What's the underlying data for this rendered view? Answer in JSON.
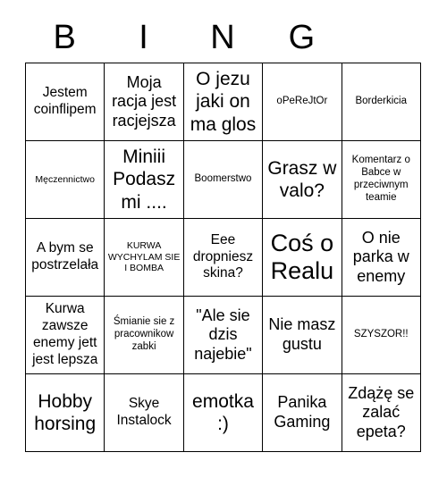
{
  "card": {
    "title_letters": [
      "B",
      "I",
      "N",
      "G",
      ""
    ],
    "columns": 5,
    "rows": 5,
    "border_color": "#000000",
    "text_color": "#000000",
    "background_color": "#ffffff",
    "cells": [
      [
        {
          "text": "Jestem coinflipem",
          "size": "md"
        },
        {
          "text": "Moja racja jest racjejsza",
          "size": "lg"
        },
        {
          "text": "O jezu jaki on ma glos",
          "size": "xl"
        },
        {
          "text": "oPeReJtOr",
          "size": "sm"
        },
        {
          "text": "Borderkicia",
          "size": "sm"
        }
      ],
      [
        {
          "text": "Męczennictwo",
          "size": "xs"
        },
        {
          "text": "Miniii Podasz mi ....",
          "size": "xl"
        },
        {
          "text": "Boomerstwo",
          "size": "sm"
        },
        {
          "text": "Grasz w valo?",
          "size": "xl"
        },
        {
          "text": "Komentarz o Babce w przeciwnym teamie",
          "size": "sm"
        }
      ],
      [
        {
          "text": "A bym se postrzelała",
          "size": "md"
        },
        {
          "text": "KURWA WYCHYLAM SIE I BOMBA",
          "size": "xs"
        },
        {
          "text": "Eee dropniesz skina?",
          "size": "md"
        },
        {
          "text": "Coś o Realu",
          "size": "xxl"
        },
        {
          "text": "O nie parka w enemy",
          "size": "lg"
        }
      ],
      [
        {
          "text": "Kurwa zawsze enemy jett jest lepsza",
          "size": "md"
        },
        {
          "text": "Śmianie sie z pracownikow zabki",
          "size": "sm"
        },
        {
          "text": "\"Ale sie dzis najebie\"",
          "size": "lg"
        },
        {
          "text": "Nie masz gustu",
          "size": "lg"
        },
        {
          "text": "SZYSZOR!!",
          "size": "sm"
        }
      ],
      [
        {
          "text": "Hobby horsing",
          "size": "xl"
        },
        {
          "text": "Skye Instalock",
          "size": "md"
        },
        {
          "text": "emotka :)",
          "size": "xl"
        },
        {
          "text": "Panika Gaming",
          "size": "lg"
        },
        {
          "text": "Zdążę se zalać epeta?",
          "size": "lg"
        }
      ]
    ]
  }
}
